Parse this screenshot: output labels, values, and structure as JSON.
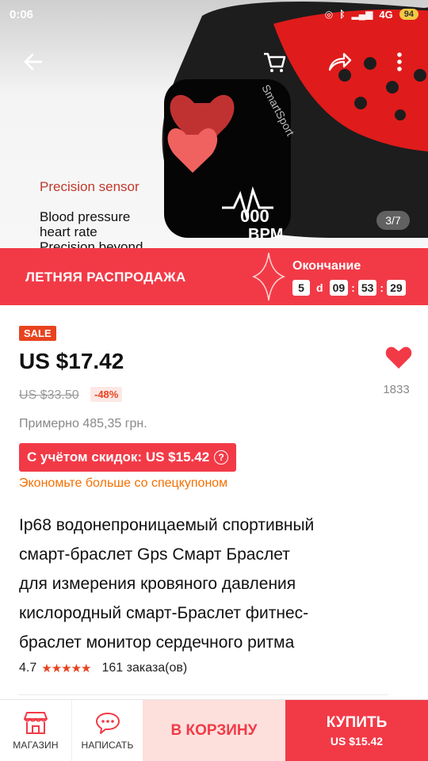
{
  "status_bar": {
    "time": "0:06",
    "network": "4G",
    "battery": "94"
  },
  "hero": {
    "promo_heading": "Precision sensor",
    "spec_lines": [
      "Blood pressure",
      "heart rate",
      "Precision beyond"
    ],
    "band_brand": "SmartSport",
    "band_display_value": "000",
    "band_display_unit": "BPM",
    "image_counter": "3/7"
  },
  "sale_banner": {
    "title": "ЛЕТНЯЯ РАСПРОДАЖА",
    "ends_label": "Окончание",
    "days": "5",
    "days_unit": "d",
    "hours": "09",
    "minutes": "53",
    "seconds": "29"
  },
  "price": {
    "sale_tag": "SALE",
    "current": "US $17.42",
    "original": "US $33.50",
    "discount": "-48%",
    "approx": "Примерно 485,35 грн.",
    "with_discounts": "С учётом скидок: US $15.42",
    "coupon_note": "Экономьте больше со спецкупоном"
  },
  "wishlist": {
    "count": "1833"
  },
  "product": {
    "title_lines": [
      "Ip68 водонепроницаемый спортивный",
      "смарт-браслет Gps Смарт Браслет",
      "для измерения кровяного давления",
      "кислородный смарт-Браслет фитнес-",
      "браслет монитор сердечного ритма"
    ],
    "rating": "4.7",
    "stars": "★★★★★",
    "orders": "161 заказа(ов)"
  },
  "bottom_bar": {
    "store_label": "МАГАЗИН",
    "message_label": "НАПИСАТЬ",
    "add_to_cart_label": "В КОРЗИНУ",
    "buy_label": "КУПИТЬ",
    "buy_price": "US $15.42"
  },
  "colors": {
    "accent": "#f23a47",
    "sale_tag": "#e8431f",
    "coupon_text": "#f56f00"
  }
}
